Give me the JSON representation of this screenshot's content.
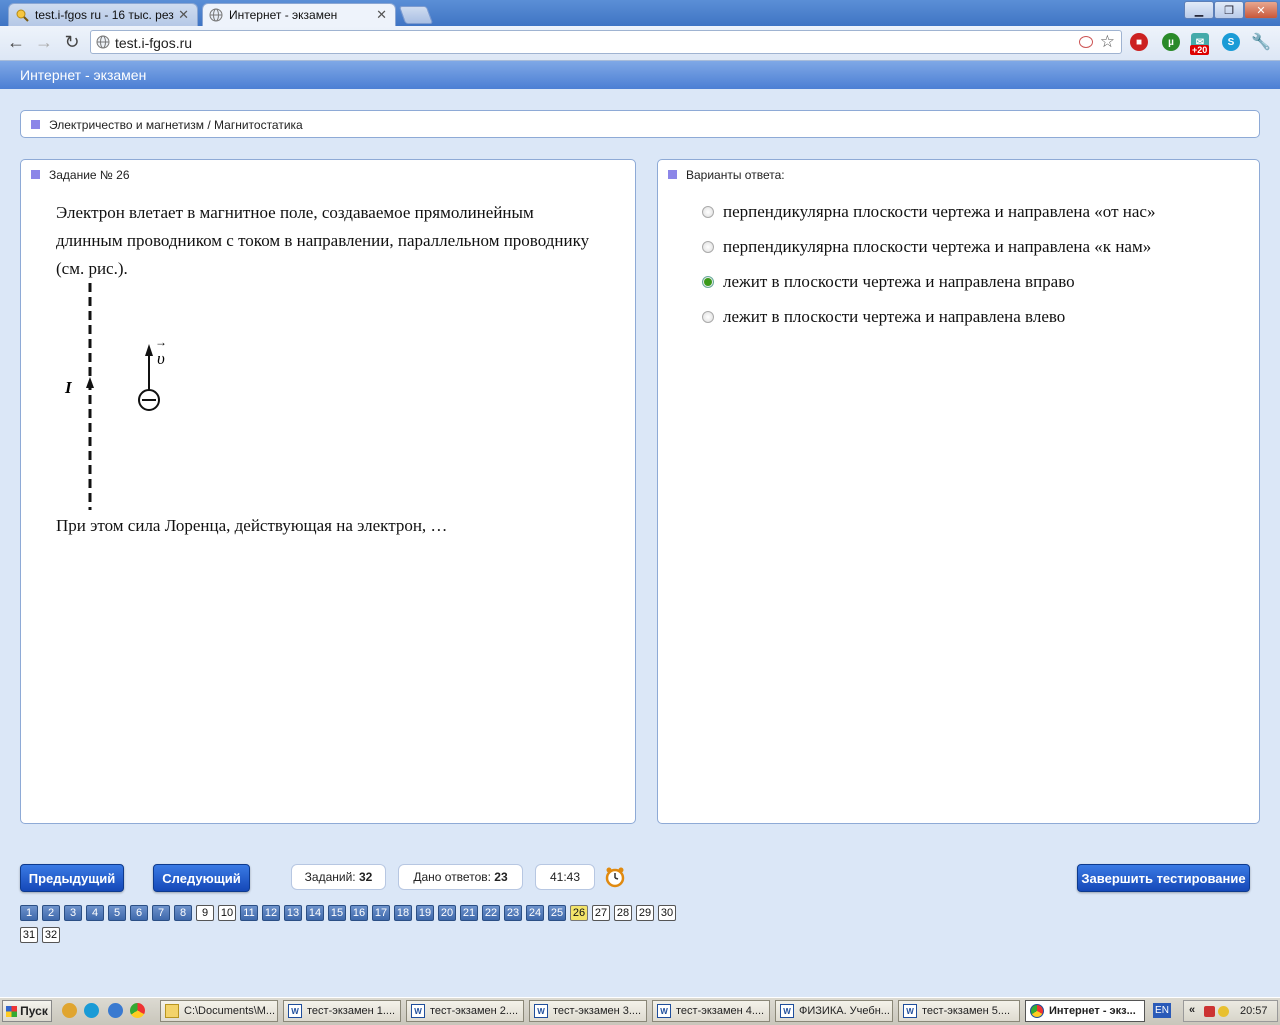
{
  "browser": {
    "tabs": [
      {
        "title": "test.i-fgos ru - 16 тыс. резул",
        "icon": "search-icon"
      },
      {
        "title": "Интернет - экзамен",
        "icon": "globe-icon"
      }
    ],
    "url": "test.i-fgos.ru",
    "extension_badge": "+20"
  },
  "app": {
    "title": "Интернет - экзамен",
    "breadcrumb": "Электричество и магнетизм / Магнитостатика"
  },
  "question": {
    "header": "Задание № 26",
    "text": "Электрон влетает в магнитное поле, создаваемое прямолинейным длинным проводником с током в направлении, параллельном проводнику (см. рис.).",
    "figure": {
      "current_label": "I",
      "velocity_label": "υ",
      "charge_symbol": "−"
    },
    "tail": "При этом сила Лоренца, действующая на электрон, …"
  },
  "answers": {
    "header": "Варианты ответа:",
    "options": [
      {
        "label": "перпендикулярна плоскости чертежа и направлена «от нас»",
        "selected": false
      },
      {
        "label": "перпендикулярна плоскости чертежа и направлена «к нам»",
        "selected": false
      },
      {
        "label": "лежит в плоскости чертежа и направлена вправо",
        "selected": true
      },
      {
        "label": "лежит в плоскости чертежа и направлена влево",
        "selected": false
      }
    ]
  },
  "nav": {
    "prev_label": "Предыдущий",
    "next_label": "Следующий",
    "tasks_label": "Заданий:",
    "tasks_value": "32",
    "answered_label": "Дано ответов:",
    "answered_value": "23",
    "timer": "41:43",
    "finish_label": "Завершить тестирование",
    "current": 26,
    "numbers": [
      {
        "n": "1",
        "state": "done"
      },
      {
        "n": "2",
        "state": "done"
      },
      {
        "n": "3",
        "state": "done"
      },
      {
        "n": "4",
        "state": "done"
      },
      {
        "n": "5",
        "state": "done"
      },
      {
        "n": "6",
        "state": "done"
      },
      {
        "n": "7",
        "state": "done"
      },
      {
        "n": "8",
        "state": "done"
      },
      {
        "n": "9",
        "state": "todo"
      },
      {
        "n": "10",
        "state": "todo"
      },
      {
        "n": "11",
        "state": "done"
      },
      {
        "n": "12",
        "state": "done"
      },
      {
        "n": "13",
        "state": "done"
      },
      {
        "n": "14",
        "state": "done"
      },
      {
        "n": "15",
        "state": "done"
      },
      {
        "n": "16",
        "state": "done"
      },
      {
        "n": "17",
        "state": "done"
      },
      {
        "n": "18",
        "state": "done"
      },
      {
        "n": "19",
        "state": "done"
      },
      {
        "n": "20",
        "state": "done"
      },
      {
        "n": "21",
        "state": "done"
      },
      {
        "n": "22",
        "state": "done"
      },
      {
        "n": "23",
        "state": "done"
      },
      {
        "n": "24",
        "state": "done"
      },
      {
        "n": "25",
        "state": "done"
      },
      {
        "n": "26",
        "state": "cur"
      },
      {
        "n": "27",
        "state": "todo"
      },
      {
        "n": "28",
        "state": "todo"
      },
      {
        "n": "29",
        "state": "todo"
      },
      {
        "n": "30",
        "state": "todo"
      },
      {
        "n": "31",
        "state": "todo"
      },
      {
        "n": "32",
        "state": "todo"
      }
    ]
  },
  "taskbar": {
    "start_label": "Пуск",
    "windows": [
      {
        "label": "C:\\Documents\\M...",
        "type": "folder"
      },
      {
        "label": "тест-экзамен 1....",
        "type": "word"
      },
      {
        "label": "тест-экзамен 2....",
        "type": "word"
      },
      {
        "label": "тест-экзамен 3....",
        "type": "word"
      },
      {
        "label": "тест-экзамен 4....",
        "type": "word"
      },
      {
        "label": "ФИЗИКА. Учебн...",
        "type": "word"
      },
      {
        "label": "тест-экзамен 5....",
        "type": "word"
      },
      {
        "label": "Интернет - экз...",
        "type": "chrome",
        "active": true
      }
    ],
    "lang": "EN",
    "clock": "20:57"
  },
  "colors": {
    "accent_blue": "#1548b8",
    "header_blue": "#4c7fd4",
    "current_question": "#f3e46a",
    "selected_radio": "#3a9a1a",
    "marker": "#8c86e8"
  }
}
